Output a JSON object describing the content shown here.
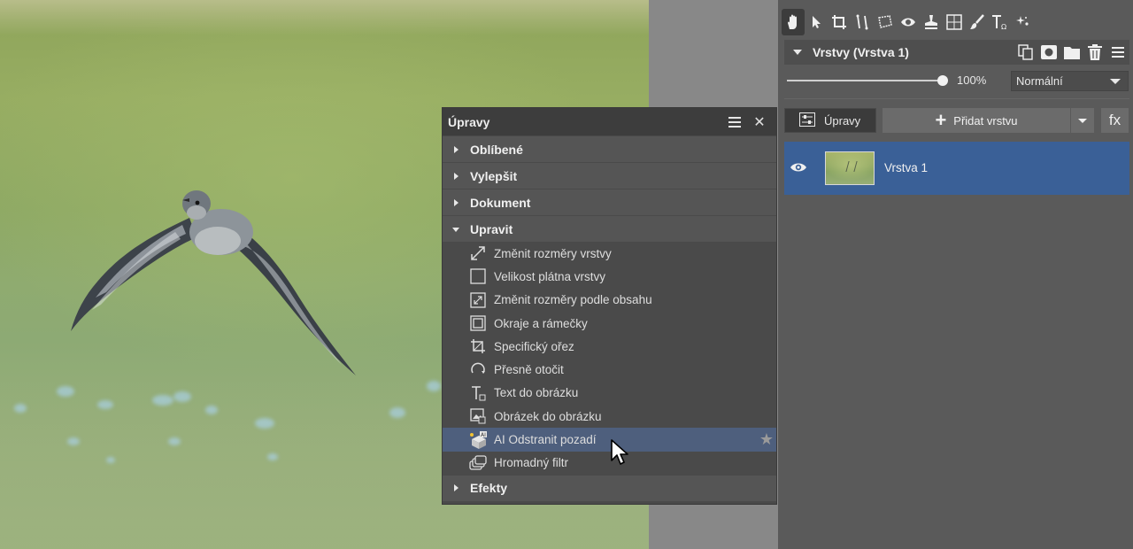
{
  "canvas": {
    "description_icon": "bird-photo"
  },
  "adjustments_panel": {
    "title": "Úpravy",
    "menu_icon": "hamburger-icon",
    "close_glyph": "✕",
    "sections": {
      "oblibene": "Oblíbené",
      "vylepsit": "Vylepšit",
      "dokument": "Dokument",
      "upravit": "Upravit",
      "efekty": "Efekty"
    },
    "items": [
      {
        "label": "Změnit rozměry vrstvy",
        "icon": "resize-arrows-icon"
      },
      {
        "label": "Velikost plátna vrstvy",
        "icon": "canvas-size-icon"
      },
      {
        "label": "Změnit rozměry podle obsahu",
        "icon": "fit-content-icon"
      },
      {
        "label": "Okraje a rámečky",
        "icon": "frame-icon"
      },
      {
        "label": "Specifický ořez",
        "icon": "crop-icon"
      },
      {
        "label": "Přesně otočit",
        "icon": "rotate-icon"
      },
      {
        "label": "Text do obrázku",
        "icon": "text-icon"
      },
      {
        "label": "Obrázek do obrázku",
        "icon": "image-in-image-icon"
      },
      {
        "label": "AI Odstranit pozadí",
        "icon": "ai-remove-bg-icon",
        "selected": true
      },
      {
        "label": "Hromadný filtr",
        "icon": "batch-filter-icon"
      }
    ]
  },
  "layers_panel": {
    "title": "Vrstvy (Vrstva 1)",
    "opacity": "100%",
    "opacity_value": 1.0,
    "blend_mode": "Normální",
    "adjust_button": "Úpravy",
    "add_layer_button": "Přidat vrstvu",
    "fx_button": "fx",
    "layers": [
      {
        "name": "Vrstva 1",
        "visible": true,
        "selected": true
      }
    ]
  },
  "colors": {
    "selection_blue": "#3a6097",
    "menu_highlight": "#4e5f7d",
    "panel_bg": "#4a4a4a"
  }
}
